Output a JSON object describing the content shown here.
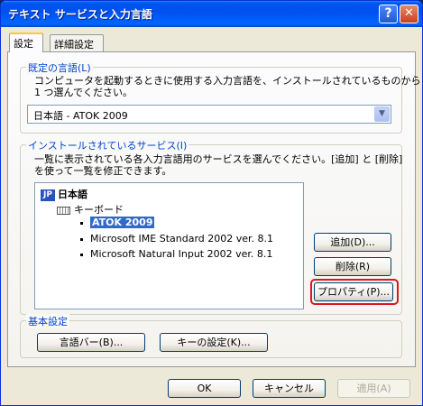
{
  "window": {
    "title": "テキスト サービスと入力言語"
  },
  "titlebar": {
    "help_glyph": "?",
    "close_glyph": "✕"
  },
  "tabs": [
    {
      "label": "設定",
      "active": true
    },
    {
      "label": "詳細設定",
      "active": false
    }
  ],
  "default_language": {
    "group_title": "既定の言語(L)",
    "description_line1": "コンピュータを起動するときに使用する入力言語を、インストールされているものから",
    "description_line2": "1 つ選んでください。",
    "selected_value": "日本語 - ATOK 2009",
    "dropdown_glyph": "▼"
  },
  "installed_services": {
    "group_title": "インストールされているサービス(I)",
    "description_line1": "一覧に表示されている各入力言語用のサービスを選んでください。[追加] と [削除]",
    "description_line2": "を使って一覧を修正できます。",
    "tree": {
      "language_badge": "JP",
      "language": "日本語",
      "category": "キーボード",
      "services": [
        "ATOK 2009",
        "Microsoft IME Standard 2002 ver. 8.1",
        "Microsoft Natural Input 2002 ver. 8.1"
      ],
      "selected_index": 0
    },
    "buttons": {
      "add": "追加(D)...",
      "remove": "削除(R)",
      "properties": "プロパティ(P)..."
    }
  },
  "basic_settings": {
    "group_title": "基本設定",
    "language_bar_button": "言語バー(B)...",
    "key_settings_button": "キーの設定(K)..."
  },
  "footer": {
    "ok": "OK",
    "cancel": "キャンセル",
    "apply": "適用(A)"
  },
  "colors": {
    "titlebar": "#0058ee",
    "dialog_bg": "#ece9d8",
    "group_title": "#0046d5",
    "selection": "#316ac5",
    "highlight_ring": "#e0141e"
  }
}
